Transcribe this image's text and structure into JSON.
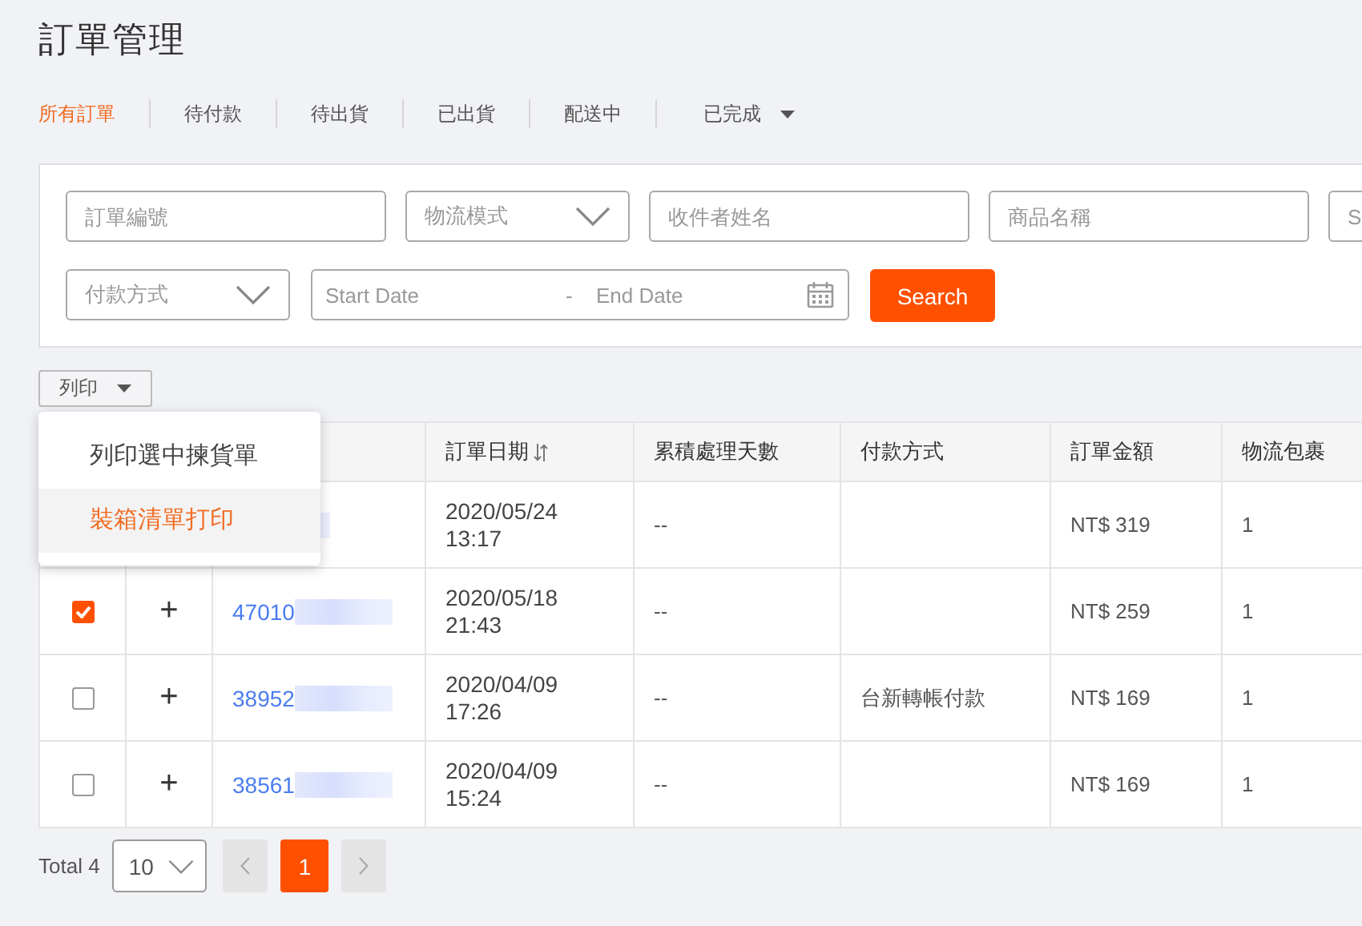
{
  "page_title": "訂單管理",
  "tabs": [
    {
      "label": "所有訂單",
      "selected": true,
      "dropdown": false
    },
    {
      "label": "待付款",
      "selected": false,
      "dropdown": false
    },
    {
      "label": "待出貨",
      "selected": false,
      "dropdown": false
    },
    {
      "label": "已出貨",
      "selected": false,
      "dropdown": false
    },
    {
      "label": "配送中",
      "selected": false,
      "dropdown": false
    },
    {
      "label": "已完成",
      "selected": false,
      "dropdown": true
    }
  ],
  "filters": [
    [
      {
        "kind": "text",
        "placeholder": "訂單編號"
      },
      {
        "kind": "select",
        "placeholder": "物流模式"
      },
      {
        "kind": "text",
        "placeholder": "收件者姓名"
      },
      {
        "kind": "text",
        "placeholder": "商品名稱"
      },
      {
        "kind": "text",
        "placeholder": "S"
      }
    ],
    [
      {
        "kind": "select",
        "placeholder": "付款方式"
      },
      {
        "kind": "daterange",
        "start_placeholder": "Start Date",
        "separator": "-",
        "end_placeholder": "End Date"
      },
      {
        "kind": "button",
        "label": "Search"
      }
    ]
  ],
  "print_button": {
    "label": "列印"
  },
  "print_menu": [
    {
      "label": "列印選中揀貨單",
      "highlighted": false
    },
    {
      "label": "裝箱清單打印",
      "highlighted": true
    }
  ],
  "table": {
    "columns": [
      {
        "label": "訂單日期",
        "sortable": true
      },
      {
        "label": "累積處理天數",
        "sortable": false
      },
      {
        "label": "付款方式",
        "sortable": false
      },
      {
        "label": "訂單金額",
        "sortable": false
      },
      {
        "label": "物流包裹",
        "sortable": false
      }
    ],
    "rows": [
      {
        "order_blurred": true,
        "date": "2020/05/24",
        "time": "13:17",
        "days": "--",
        "payment": "",
        "amount": "NT$ 319",
        "packages": "1"
      },
      {
        "checked": true,
        "expand": "+",
        "order_no": "47010",
        "order_blurred": true,
        "date": "2020/05/18",
        "time": "21:43",
        "days": "--",
        "payment": "",
        "amount": "NT$ 259",
        "packages": "1"
      },
      {
        "checked": false,
        "expand": "+",
        "order_no": "38952",
        "order_blurred": true,
        "date": "2020/04/09",
        "time": "17:26",
        "days": "--",
        "payment": "台新轉帳付款",
        "amount": "NT$ 169",
        "packages": "1"
      },
      {
        "checked": false,
        "expand": "+",
        "order_no": "38561",
        "order_blurred": true,
        "date": "2020/04/09",
        "time": "15:24",
        "days": "--",
        "payment": "",
        "amount": "NT$ 169",
        "packages": "1"
      }
    ]
  },
  "pagination": {
    "total": "Total 4",
    "page_size": "10",
    "pages": [
      {
        "label": "1",
        "selected": true
      }
    ],
    "prev_disabled": true,
    "next_disabled": true
  }
}
